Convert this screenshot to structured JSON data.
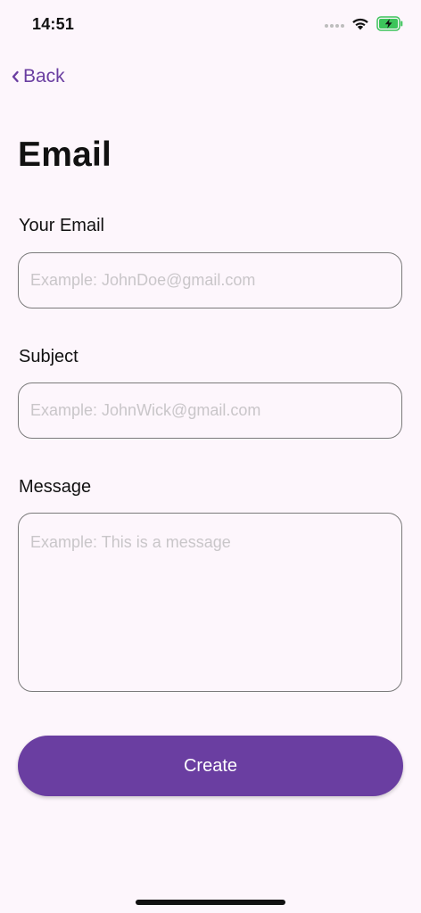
{
  "status_bar": {
    "time": "14:51",
    "icons": [
      "signal-dots-icon",
      "wifi-icon",
      "battery-charging-icon"
    ],
    "battery_color": "#3cc45b"
  },
  "nav": {
    "back_label": "Back",
    "back_icon": "chevron-left-icon"
  },
  "page": {
    "title": "Email"
  },
  "form": {
    "email": {
      "label": "Your Email",
      "value": "",
      "placeholder": "Example: JohnDoe@gmail.com"
    },
    "subject": {
      "label": "Subject",
      "value": "",
      "placeholder": "Example: JohnWick@gmail.com"
    },
    "message": {
      "label": "Message",
      "value": "",
      "placeholder": "Example: This is a message"
    },
    "submit_label": "Create"
  },
  "colors": {
    "accent": "#6a3ea1",
    "background": "#fdf6fc",
    "border": "#7a7a7a",
    "placeholder": "#c9c6c9"
  }
}
